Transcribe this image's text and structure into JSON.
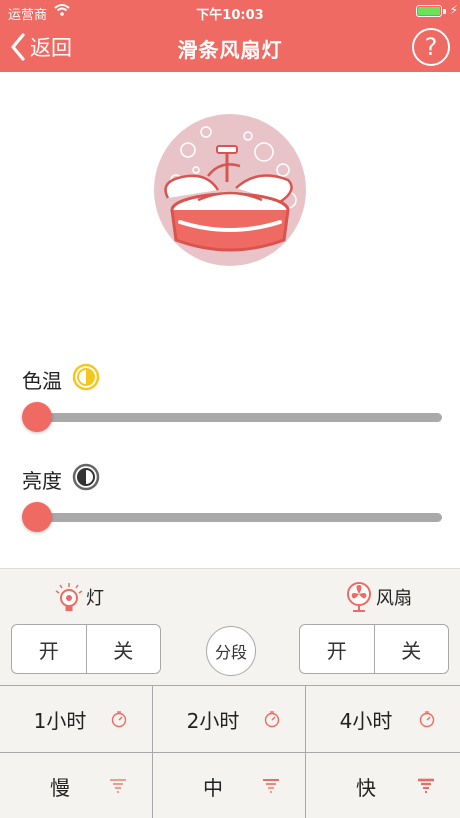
{
  "status_bar": {
    "carrier": "运营商",
    "time": "下午10:03"
  },
  "nav": {
    "back_label": "返回",
    "title": "滑条风扇灯",
    "help_symbol": "?"
  },
  "color_temp": {
    "label": "色温",
    "value_fraction": 0.0
  },
  "brightness": {
    "label": "亮度",
    "value_fraction": 0.0
  },
  "light": {
    "label": "灯",
    "on": "开",
    "off": "关"
  },
  "segment_button": "分段",
  "fan": {
    "label": "风扇",
    "on": "开",
    "off": "关"
  },
  "timers": [
    "1小时",
    "2小时",
    "4小时"
  ],
  "speeds": [
    "慢",
    "中",
    "快"
  ],
  "colors": {
    "accent": "#ee6a62",
    "track": "#a9a9a9",
    "panel_bg": "#f5f3ef"
  }
}
